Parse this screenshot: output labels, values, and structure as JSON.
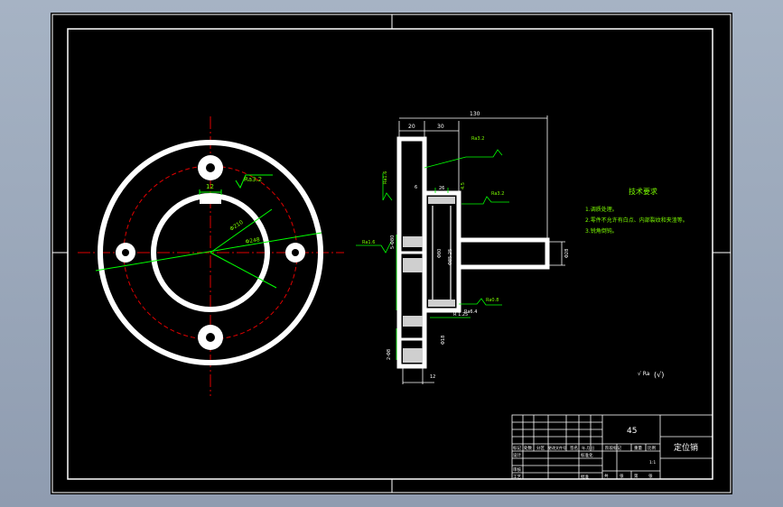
{
  "front_view": {
    "dims": {
      "keyway": "12",
      "roughness": "Ra3.2",
      "bolt_circle": "Φ210",
      "outer": "Φ248"
    }
  },
  "section_view": {
    "dims": {
      "total_length": "130",
      "w_20": "20",
      "w_30": "30",
      "w_6": "6",
      "w_26": "26",
      "depth_45": "4.5",
      "ra_1": "Ra3.2",
      "ra_2": "Ra1.6",
      "ra_3": "Ra3.2",
      "ra_4": "Ra1.6",
      "ra_5": "Ra0.8",
      "ra_6": "Ra6.4",
      "bore": "5-Φ80",
      "phi_1": "Φ80",
      "phi_2": "Φ85.25",
      "phi_3": "Φ28",
      "phi_4": "Φ18",
      "r_label": "R 1.25",
      "bottom_12": "12",
      "left_vert": "2-Φ8"
    }
  },
  "tech_req": {
    "title": "技术要求",
    "items": [
      "1.调质处理。",
      "2.零件不允许有白点、内部裂纹和夹渣等。",
      "3.锐角倒钝。"
    ]
  },
  "roughness_note": {
    "symbol": "√ Ra",
    "paren": "(√)"
  },
  "title_block": {
    "material": "45",
    "part_name": "定位销",
    "row1": [
      "标记",
      "处数",
      "分区",
      "更改文件号",
      "签名",
      "年.月.日"
    ],
    "row2": [
      "设计",
      "",
      "标准化"
    ],
    "row2b": [
      "阶段标记",
      "重量",
      "比例"
    ],
    "row3": [
      "审核"
    ],
    "row4": [
      "工艺",
      "批准"
    ],
    "row4b": [
      "共",
      "张",
      "第",
      "张"
    ],
    "scale": "1:1"
  }
}
